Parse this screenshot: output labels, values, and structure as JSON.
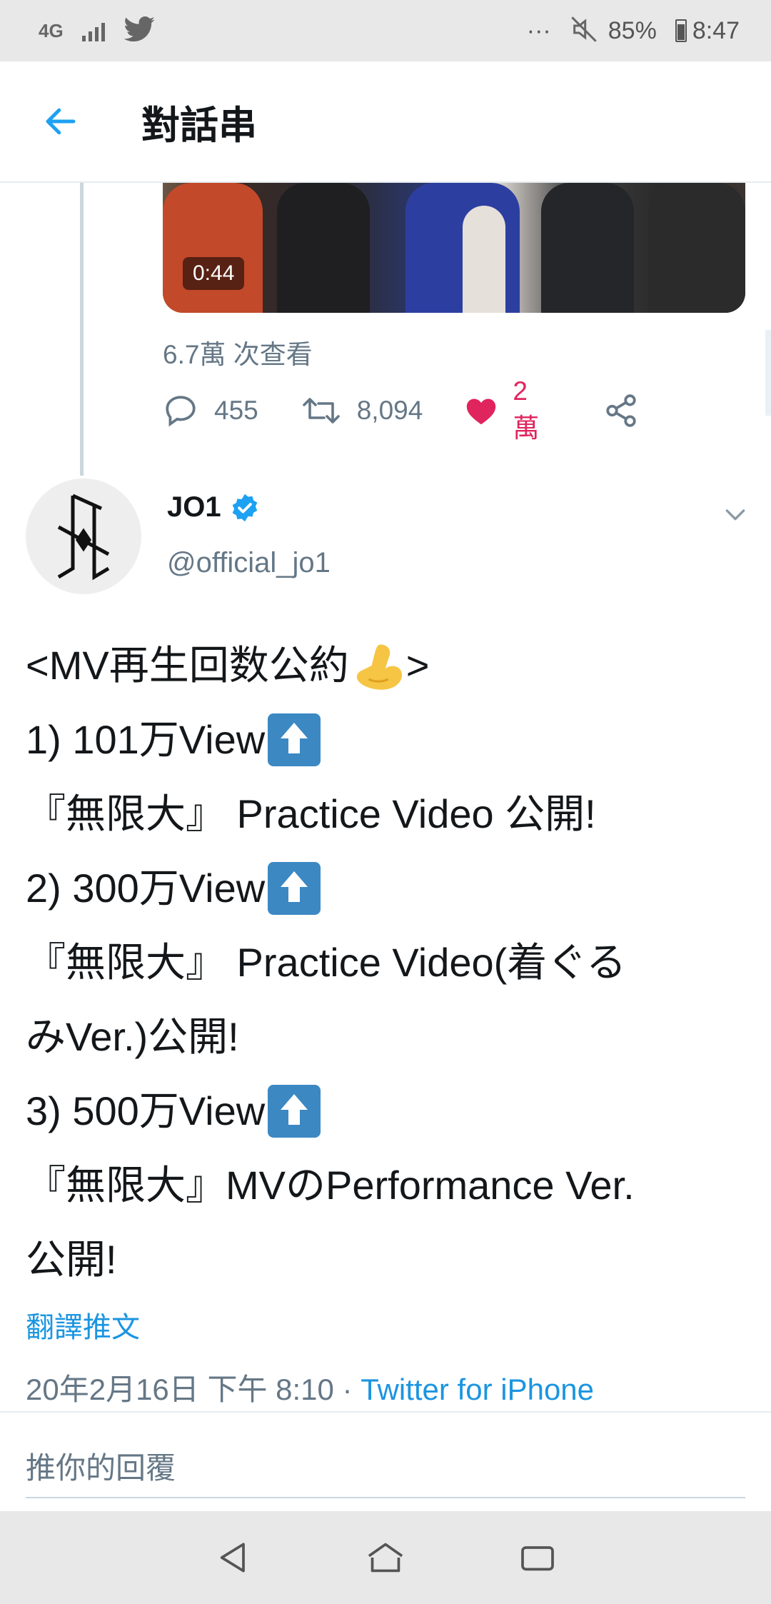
{
  "status_bar": {
    "network": "4G",
    "dots": "···",
    "battery": "85%",
    "time": "8:47",
    "icons": [
      "signal-icon",
      "twitter-bird-icon",
      "mute-icon",
      "battery-icon"
    ]
  },
  "header": {
    "title": "對話串",
    "back_icon": "arrow-left-icon"
  },
  "previous_tweet": {
    "video_duration": "0:44",
    "views": "6.7萬 次查看",
    "reply_count": "455",
    "retweet_count": "8,094",
    "like_count": "2萬",
    "liked": true
  },
  "tweet": {
    "display_name": "JO1",
    "verified": true,
    "handle": "@official_jo1",
    "lines": [
      {
        "text": "<MV再生回数公約",
        "emoji": "flexed-biceps",
        "after": ">"
      },
      {
        "text": "1) 101万View",
        "emoji": "up-button"
      },
      {
        "text": "『無限大』 Practice Video 公開!"
      },
      {
        "text": "2) 300万View",
        "emoji": "up-button"
      },
      {
        "text": "『無限大』 Practice Video(着ぐる"
      },
      {
        "text": "みVer.)公開!"
      },
      {
        "text": "3) 500万View",
        "emoji": "up-button"
      },
      {
        "text": "『無限大』MVのPerformance Ver."
      },
      {
        "text": "公開!"
      }
    ],
    "translate_label": "翻譯推文",
    "timestamp": "20年2月16日 下午 8:10",
    "separator": " · ",
    "source": "Twitter for iPhone"
  },
  "reply": {
    "placeholder": "推你的回覆"
  },
  "colors": {
    "accent": "#1da1f2",
    "like": "#e0245e",
    "secondary_text": "#657786"
  }
}
